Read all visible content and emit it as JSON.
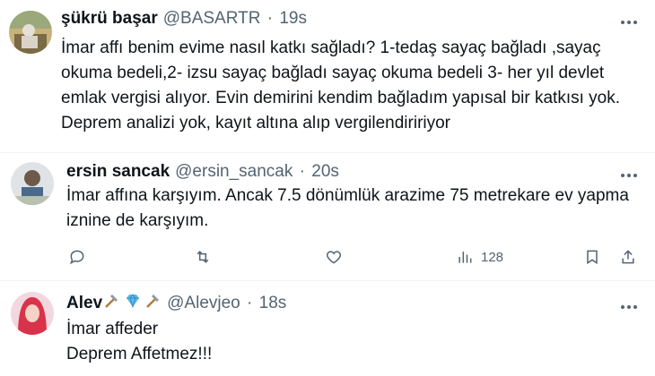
{
  "tweets": [
    {
      "name": "şükrü başar",
      "handle": "@BASARTR",
      "dot": "·",
      "time": "19s",
      "text": "İmar affı benim evime nasıl katkı sağladı? 1-tedaş sayaç bağladı ,sayaç\nokuma bedeli,2- izsu sayaç bağladı sayaç okuma bedeli 3- her yıl devlet\nemlak vergisi alıyor. Evin demirini kendim bağladım yapısal bir katkısı yok.\nDeprem analizi yok, kayıt altına alıp vergilendiririyor"
    },
    {
      "name": "ersin sancak",
      "handle": "@ersin_sancak",
      "dot": "·",
      "time": "20s",
      "text": "İmar affına karşıyım. Ancak 7.5 dönümlük arazime 75 metrekare ev yapma\niznine de karşıyım.",
      "actions": {
        "views_count": "128"
      }
    },
    {
      "name": "Alev",
      "handle": "@Alevjeo",
      "dot": "·",
      "time": "18s",
      "text": "İmar affeder\nDeprem Affetmez!!!"
    }
  ],
  "icons": {
    "more": "more-horizontal-icon",
    "reply": "reply-icon",
    "retweet": "retweet-icon",
    "like": "heart-icon",
    "views": "views-chart-icon",
    "bookmark": "bookmark-icon",
    "share": "share-icon",
    "name_emojis": [
      "hammer-pick-icon",
      "gem-icon",
      "hammer-pick-icon"
    ]
  },
  "colors": {
    "text": "#0f1419",
    "secondary": "#536471",
    "divider": "#eff3f4"
  }
}
